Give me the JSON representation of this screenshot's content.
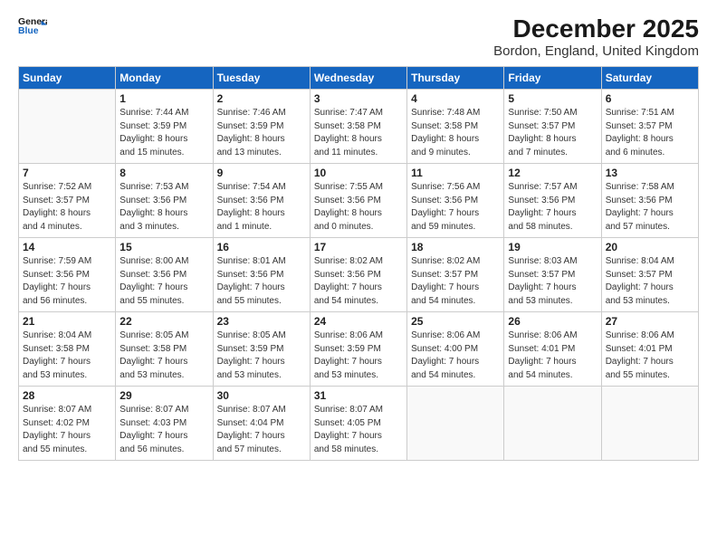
{
  "logo": {
    "line1": "General",
    "line2": "Blue"
  },
  "title": "December 2025",
  "subtitle": "Bordon, England, United Kingdom",
  "days_of_week": [
    "Sunday",
    "Monday",
    "Tuesday",
    "Wednesday",
    "Thursday",
    "Friday",
    "Saturday"
  ],
  "weeks": [
    [
      {
        "day": "",
        "info": ""
      },
      {
        "day": "1",
        "info": "Sunrise: 7:44 AM\nSunset: 3:59 PM\nDaylight: 8 hours\nand 15 minutes."
      },
      {
        "day": "2",
        "info": "Sunrise: 7:46 AM\nSunset: 3:59 PM\nDaylight: 8 hours\nand 13 minutes."
      },
      {
        "day": "3",
        "info": "Sunrise: 7:47 AM\nSunset: 3:58 PM\nDaylight: 8 hours\nand 11 minutes."
      },
      {
        "day": "4",
        "info": "Sunrise: 7:48 AM\nSunset: 3:58 PM\nDaylight: 8 hours\nand 9 minutes."
      },
      {
        "day": "5",
        "info": "Sunrise: 7:50 AM\nSunset: 3:57 PM\nDaylight: 8 hours\nand 7 minutes."
      },
      {
        "day": "6",
        "info": "Sunrise: 7:51 AM\nSunset: 3:57 PM\nDaylight: 8 hours\nand 6 minutes."
      }
    ],
    [
      {
        "day": "7",
        "info": "Sunrise: 7:52 AM\nSunset: 3:57 PM\nDaylight: 8 hours\nand 4 minutes."
      },
      {
        "day": "8",
        "info": "Sunrise: 7:53 AM\nSunset: 3:56 PM\nDaylight: 8 hours\nand 3 minutes."
      },
      {
        "day": "9",
        "info": "Sunrise: 7:54 AM\nSunset: 3:56 PM\nDaylight: 8 hours\nand 1 minute."
      },
      {
        "day": "10",
        "info": "Sunrise: 7:55 AM\nSunset: 3:56 PM\nDaylight: 8 hours\nand 0 minutes."
      },
      {
        "day": "11",
        "info": "Sunrise: 7:56 AM\nSunset: 3:56 PM\nDaylight: 7 hours\nand 59 minutes."
      },
      {
        "day": "12",
        "info": "Sunrise: 7:57 AM\nSunset: 3:56 PM\nDaylight: 7 hours\nand 58 minutes."
      },
      {
        "day": "13",
        "info": "Sunrise: 7:58 AM\nSunset: 3:56 PM\nDaylight: 7 hours\nand 57 minutes."
      }
    ],
    [
      {
        "day": "14",
        "info": "Sunrise: 7:59 AM\nSunset: 3:56 PM\nDaylight: 7 hours\nand 56 minutes."
      },
      {
        "day": "15",
        "info": "Sunrise: 8:00 AM\nSunset: 3:56 PM\nDaylight: 7 hours\nand 55 minutes."
      },
      {
        "day": "16",
        "info": "Sunrise: 8:01 AM\nSunset: 3:56 PM\nDaylight: 7 hours\nand 55 minutes."
      },
      {
        "day": "17",
        "info": "Sunrise: 8:02 AM\nSunset: 3:56 PM\nDaylight: 7 hours\nand 54 minutes."
      },
      {
        "day": "18",
        "info": "Sunrise: 8:02 AM\nSunset: 3:57 PM\nDaylight: 7 hours\nand 54 minutes."
      },
      {
        "day": "19",
        "info": "Sunrise: 8:03 AM\nSunset: 3:57 PM\nDaylight: 7 hours\nand 53 minutes."
      },
      {
        "day": "20",
        "info": "Sunrise: 8:04 AM\nSunset: 3:57 PM\nDaylight: 7 hours\nand 53 minutes."
      }
    ],
    [
      {
        "day": "21",
        "info": "Sunrise: 8:04 AM\nSunset: 3:58 PM\nDaylight: 7 hours\nand 53 minutes."
      },
      {
        "day": "22",
        "info": "Sunrise: 8:05 AM\nSunset: 3:58 PM\nDaylight: 7 hours\nand 53 minutes."
      },
      {
        "day": "23",
        "info": "Sunrise: 8:05 AM\nSunset: 3:59 PM\nDaylight: 7 hours\nand 53 minutes."
      },
      {
        "day": "24",
        "info": "Sunrise: 8:06 AM\nSunset: 3:59 PM\nDaylight: 7 hours\nand 53 minutes."
      },
      {
        "day": "25",
        "info": "Sunrise: 8:06 AM\nSunset: 4:00 PM\nDaylight: 7 hours\nand 54 minutes."
      },
      {
        "day": "26",
        "info": "Sunrise: 8:06 AM\nSunset: 4:01 PM\nDaylight: 7 hours\nand 54 minutes."
      },
      {
        "day": "27",
        "info": "Sunrise: 8:06 AM\nSunset: 4:01 PM\nDaylight: 7 hours\nand 55 minutes."
      }
    ],
    [
      {
        "day": "28",
        "info": "Sunrise: 8:07 AM\nSunset: 4:02 PM\nDaylight: 7 hours\nand 55 minutes."
      },
      {
        "day": "29",
        "info": "Sunrise: 8:07 AM\nSunset: 4:03 PM\nDaylight: 7 hours\nand 56 minutes."
      },
      {
        "day": "30",
        "info": "Sunrise: 8:07 AM\nSunset: 4:04 PM\nDaylight: 7 hours\nand 57 minutes."
      },
      {
        "day": "31",
        "info": "Sunrise: 8:07 AM\nSunset: 4:05 PM\nDaylight: 7 hours\nand 58 minutes."
      },
      {
        "day": "",
        "info": ""
      },
      {
        "day": "",
        "info": ""
      },
      {
        "day": "",
        "info": ""
      }
    ]
  ]
}
